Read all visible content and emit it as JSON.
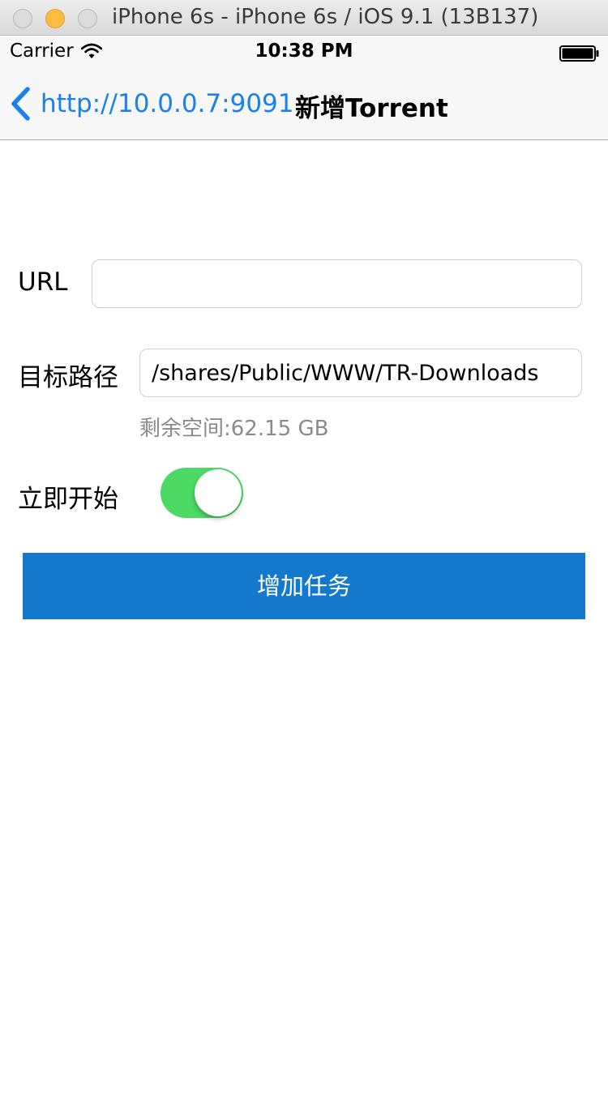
{
  "window": {
    "title": "iPhone 6s - iPhone 6s / iOS 9.1 (13B137)"
  },
  "status_bar": {
    "carrier": "Carrier",
    "time": "10:38 PM",
    "wifi_icon": "wifi-icon",
    "battery_icon": "battery-icon"
  },
  "nav": {
    "back_label": "http://10.0.0.7:9091",
    "back_icon": "chevron-left-icon",
    "title": "新增Torrent"
  },
  "form": {
    "url_label": "URL",
    "url_value": "",
    "path_label": "目标路径",
    "path_value": "/shares/Public/WWW/TR-Downloads",
    "free_space": "剩余空间:62.15 GB",
    "start_label": "立即开始",
    "start_now": true,
    "submit_label": "增加任务"
  },
  "colors": {
    "accent": "#1a7ff0",
    "toggle_on": "#4cd964",
    "button": "#1479cc"
  }
}
